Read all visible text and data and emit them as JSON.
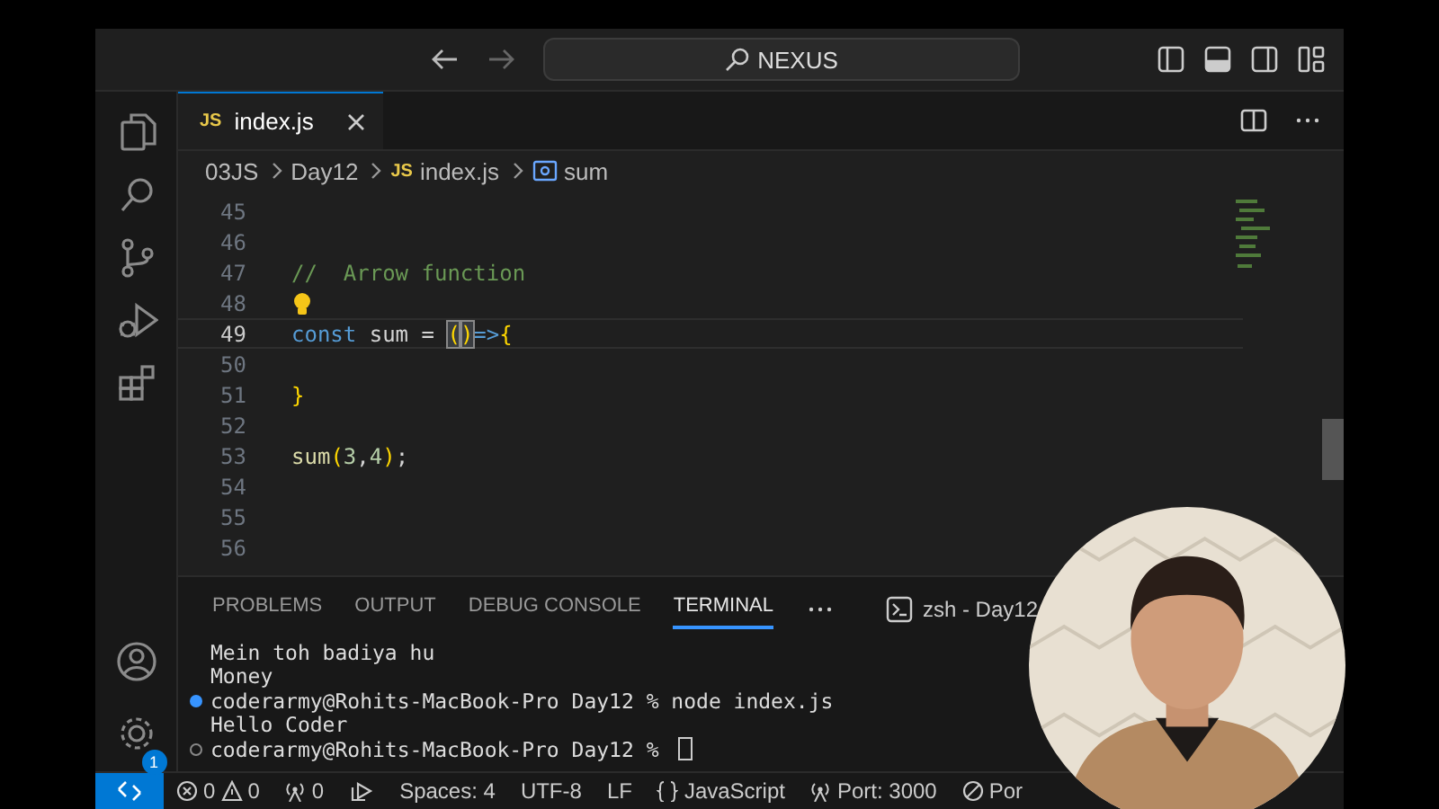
{
  "title_bar": {
    "search": "NEXUS",
    "layout_toggles": [
      {
        "kind": "sidebar",
        "on": false
      },
      {
        "kind": "panel",
        "on": true
      },
      {
        "kind": "secondary",
        "on": false
      },
      {
        "kind": "custom",
        "on": false
      }
    ]
  },
  "activity_bar": {
    "top": [
      {
        "kind": "explorer"
      },
      {
        "kind": "search"
      },
      {
        "kind": "source-control"
      },
      {
        "kind": "run"
      },
      {
        "kind": "extensions"
      }
    ],
    "bottom": [
      {
        "kind": "account"
      },
      {
        "kind": "manage",
        "badge": "1"
      }
    ]
  },
  "tabs": [
    {
      "badge": "JS",
      "label": "index.js",
      "selected": true
    }
  ],
  "breadcrumb": [
    {
      "kind": "folder",
      "text": "03JS"
    },
    {
      "kind": "folder",
      "text": "Day12"
    },
    {
      "kind": "file",
      "badge": "JS",
      "text": "index.js"
    },
    {
      "kind": "symbol",
      "text": "sum"
    }
  ],
  "editor": {
    "lines": [
      {
        "number": "45",
        "current": false,
        "lightbulb": false
      },
      {
        "number": "46",
        "current": false,
        "lightbulb": false
      },
      {
        "number": "47",
        "current": false,
        "lightbulb": false,
        "tokens": [
          {
            "kind": "comment",
            "text": "//  Arrow function",
            "matched": false
          }
        ]
      },
      {
        "number": "48",
        "current": false,
        "lightbulb": true
      },
      {
        "number": "49",
        "current": true,
        "lightbulb": false,
        "tokens": [
          {
            "kind": "keyword",
            "text": "const",
            "matched": false
          },
          {
            "kind": "ident",
            "text": " sum = ",
            "matched": false
          },
          {
            "kind": "bracket",
            "text": "(",
            "matched": true
          },
          {
            "kind": "bracket",
            "text": ")",
            "matched": true
          },
          {
            "kind": "keyword",
            "text": "=>",
            "matched": false
          },
          {
            "kind": "bracket",
            "text": "{",
            "matched": false
          }
        ]
      },
      {
        "number": "50",
        "current": false,
        "lightbulb": false
      },
      {
        "number": "51",
        "current": false,
        "lightbulb": false,
        "tokens": [
          {
            "kind": "bracket",
            "text": "}",
            "matched": false
          }
        ]
      },
      {
        "number": "52",
        "current": false,
        "lightbulb": false
      },
      {
        "number": "53",
        "current": false,
        "lightbulb": false,
        "tokens": [
          {
            "kind": "fn",
            "text": "sum",
            "matched": false
          },
          {
            "kind": "bracket",
            "text": "(",
            "matched": false
          },
          {
            "kind": "number",
            "text": "3",
            "matched": false
          },
          {
            "kind": "ident",
            "text": ",",
            "matched": false
          },
          {
            "kind": "number",
            "text": "4",
            "matched": false
          },
          {
            "kind": "bracket",
            "text": ")",
            "matched": false
          },
          {
            "kind": "ident",
            "text": ";",
            "matched": false
          }
        ]
      },
      {
        "number": "54",
        "current": false,
        "lightbulb": false
      },
      {
        "number": "55",
        "current": false,
        "lightbulb": false
      },
      {
        "number": "56",
        "current": false,
        "lightbulb": false
      }
    ]
  },
  "panel": {
    "tabs": [
      {
        "label": "PROBLEMS",
        "selected": false
      },
      {
        "label": "OUTPUT",
        "selected": false
      },
      {
        "label": "DEBUG CONSOLE",
        "selected": false
      },
      {
        "label": "TERMINAL",
        "selected": true
      }
    ],
    "terminal_title": "zsh - Day12",
    "terminal_lines": [
      {
        "kind": "output",
        "text": "Mein toh badiya hu"
      },
      {
        "kind": "output",
        "text": "Money"
      },
      {
        "kind": "prompt-done",
        "text": "coderarmy@Rohits-MacBook-Pro Day12 % node index.js"
      },
      {
        "kind": "output",
        "text": "Hello Coder"
      },
      {
        "kind": "prompt-open",
        "text": "coderarmy@Rohits-MacBook-Pro Day12 % ",
        "cursor": true
      }
    ]
  },
  "status_bar": [
    {
      "kind": "remote"
    },
    {
      "kind": "problems",
      "errors": "0",
      "warnings": "0"
    },
    {
      "kind": "antenna",
      "text": "0"
    },
    {
      "kind": "liveshare"
    },
    {
      "kind": "text",
      "text": "Spaces: 4"
    },
    {
      "kind": "text",
      "text": "UTF-8"
    },
    {
      "kind": "text",
      "text": "LF"
    },
    {
      "kind": "language",
      "text": "JavaScript"
    },
    {
      "kind": "antenna",
      "text": "Port: 3000"
    },
    {
      "kind": "blocked",
      "text": "Por"
    }
  ]
}
